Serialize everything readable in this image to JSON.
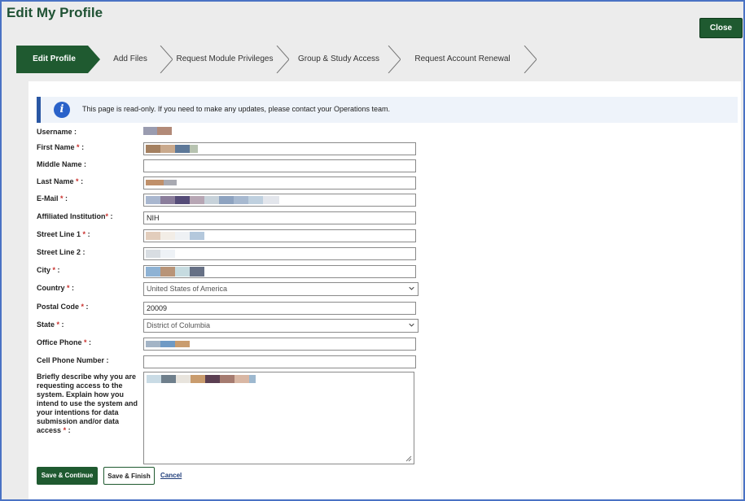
{
  "page": {
    "title": "Edit My Profile",
    "close_label": "Close"
  },
  "steps": [
    {
      "label": "Edit Profile",
      "active": true
    },
    {
      "label": "Add Files",
      "active": false
    },
    {
      "label": "Request Module Privileges",
      "active": false
    },
    {
      "label": "Group & Study Access",
      "active": false
    },
    {
      "label": "Request Account Renewal",
      "active": false
    }
  ],
  "banner": {
    "icon": "info-icon",
    "text": "This page is read-only. If you need to make any updates, please contact your Operations team."
  },
  "form": {
    "username_label": "Username :",
    "first_name_label": "First Name",
    "middle_name_label": "Middle Name :",
    "last_name_label": "Last Name",
    "email_label": "E-Mail",
    "institution_label": "Affiliated Institution",
    "institution_value": "NIH",
    "street1_label": "Street Line 1",
    "street2_label": "Street Line 2 :",
    "city_label": "City",
    "country_label": "Country",
    "country_value": "United States of America",
    "postal_label": "Postal Code",
    "postal_value": "20009",
    "state_label": "State",
    "state_value": "District of Columbia",
    "office_phone_label": "Office Phone",
    "cell_phone_label": "Cell Phone Number :",
    "reason_label": "Briefly describe why you are requesting access to the system. Explain how you intend to use the system and your intentions for data submission and/or data access",
    "required_mark": "*",
    "colon": " :"
  },
  "actions": {
    "save_continue": "Save & Continue",
    "save_finish": "Save & Finish",
    "cancel": "Cancel"
  },
  "colors": {
    "brand_green": "#1f5a30",
    "banner_blue": "#2a57a3",
    "required_red": "#c9302c"
  }
}
